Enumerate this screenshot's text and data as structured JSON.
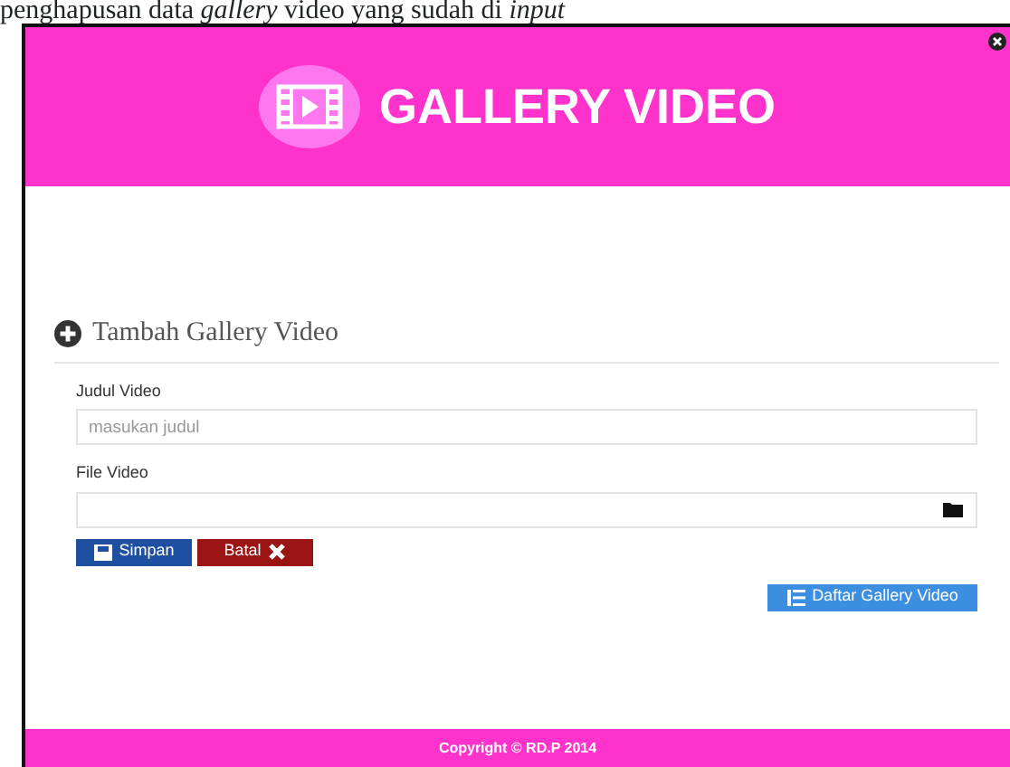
{
  "caption": "penghapusan data *gallery* video yang sudah di *input*",
  "header": {
    "title": "GALLERY VIDEO"
  },
  "form": {
    "title": "Tambah Gallery Video",
    "fields": [
      {
        "kind": "text",
        "label": "Judul Video",
        "placeholder": "masukan judul"
      },
      {
        "kind": "file",
        "label": "File Video"
      }
    ],
    "buttons": [
      {
        "kind": "save",
        "label": "Simpan"
      },
      {
        "kind": "cancel",
        "label": "Batal"
      }
    ]
  },
  "list_button": {
    "label": "Daftar Gallery Video"
  },
  "footer": {
    "text": "Copyright © RD.P 2014"
  }
}
